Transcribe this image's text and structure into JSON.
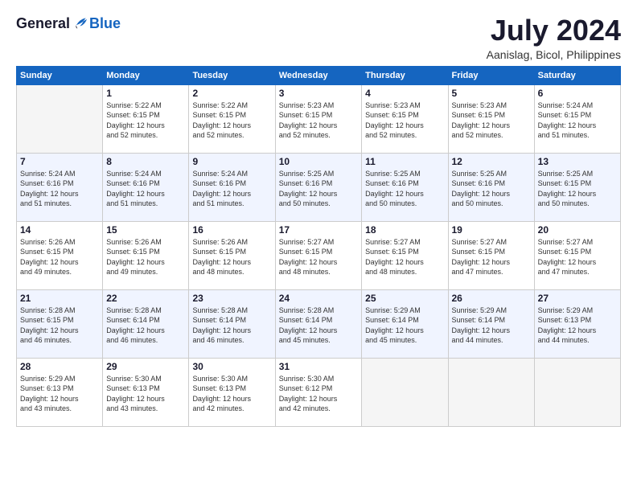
{
  "logo": {
    "general": "General",
    "blue": "Blue"
  },
  "title": "July 2024",
  "location": "Aanislag, Bicol, Philippines",
  "days_of_week": [
    "Sunday",
    "Monday",
    "Tuesday",
    "Wednesday",
    "Thursday",
    "Friday",
    "Saturday"
  ],
  "weeks": [
    [
      {
        "num": "",
        "sunrise": "",
        "sunset": "",
        "daylight": "",
        "empty": true
      },
      {
        "num": "1",
        "sunrise": "Sunrise: 5:22 AM",
        "sunset": "Sunset: 6:15 PM",
        "daylight": "Daylight: 12 hours and 52 minutes."
      },
      {
        "num": "2",
        "sunrise": "Sunrise: 5:22 AM",
        "sunset": "Sunset: 6:15 PM",
        "daylight": "Daylight: 12 hours and 52 minutes."
      },
      {
        "num": "3",
        "sunrise": "Sunrise: 5:23 AM",
        "sunset": "Sunset: 6:15 PM",
        "daylight": "Daylight: 12 hours and 52 minutes."
      },
      {
        "num": "4",
        "sunrise": "Sunrise: 5:23 AM",
        "sunset": "Sunset: 6:15 PM",
        "daylight": "Daylight: 12 hours and 52 minutes."
      },
      {
        "num": "5",
        "sunrise": "Sunrise: 5:23 AM",
        "sunset": "Sunset: 6:15 PM",
        "daylight": "Daylight: 12 hours and 52 minutes."
      },
      {
        "num": "6",
        "sunrise": "Sunrise: 5:24 AM",
        "sunset": "Sunset: 6:15 PM",
        "daylight": "Daylight: 12 hours and 51 minutes."
      }
    ],
    [
      {
        "num": "7",
        "sunrise": "Sunrise: 5:24 AM",
        "sunset": "Sunset: 6:16 PM",
        "daylight": "Daylight: 12 hours and 51 minutes."
      },
      {
        "num": "8",
        "sunrise": "Sunrise: 5:24 AM",
        "sunset": "Sunset: 6:16 PM",
        "daylight": "Daylight: 12 hours and 51 minutes."
      },
      {
        "num": "9",
        "sunrise": "Sunrise: 5:24 AM",
        "sunset": "Sunset: 6:16 PM",
        "daylight": "Daylight: 12 hours and 51 minutes."
      },
      {
        "num": "10",
        "sunrise": "Sunrise: 5:25 AM",
        "sunset": "Sunset: 6:16 PM",
        "daylight": "Daylight: 12 hours and 50 minutes."
      },
      {
        "num": "11",
        "sunrise": "Sunrise: 5:25 AM",
        "sunset": "Sunset: 6:16 PM",
        "daylight": "Daylight: 12 hours and 50 minutes."
      },
      {
        "num": "12",
        "sunrise": "Sunrise: 5:25 AM",
        "sunset": "Sunset: 6:16 PM",
        "daylight": "Daylight: 12 hours and 50 minutes."
      },
      {
        "num": "13",
        "sunrise": "Sunrise: 5:25 AM",
        "sunset": "Sunset: 6:15 PM",
        "daylight": "Daylight: 12 hours and 50 minutes."
      }
    ],
    [
      {
        "num": "14",
        "sunrise": "Sunrise: 5:26 AM",
        "sunset": "Sunset: 6:15 PM",
        "daylight": "Daylight: 12 hours and 49 minutes."
      },
      {
        "num": "15",
        "sunrise": "Sunrise: 5:26 AM",
        "sunset": "Sunset: 6:15 PM",
        "daylight": "Daylight: 12 hours and 49 minutes."
      },
      {
        "num": "16",
        "sunrise": "Sunrise: 5:26 AM",
        "sunset": "Sunset: 6:15 PM",
        "daylight": "Daylight: 12 hours and 48 minutes."
      },
      {
        "num": "17",
        "sunrise": "Sunrise: 5:27 AM",
        "sunset": "Sunset: 6:15 PM",
        "daylight": "Daylight: 12 hours and 48 minutes."
      },
      {
        "num": "18",
        "sunrise": "Sunrise: 5:27 AM",
        "sunset": "Sunset: 6:15 PM",
        "daylight": "Daylight: 12 hours and 48 minutes."
      },
      {
        "num": "19",
        "sunrise": "Sunrise: 5:27 AM",
        "sunset": "Sunset: 6:15 PM",
        "daylight": "Daylight: 12 hours and 47 minutes."
      },
      {
        "num": "20",
        "sunrise": "Sunrise: 5:27 AM",
        "sunset": "Sunset: 6:15 PM",
        "daylight": "Daylight: 12 hours and 47 minutes."
      }
    ],
    [
      {
        "num": "21",
        "sunrise": "Sunrise: 5:28 AM",
        "sunset": "Sunset: 6:15 PM",
        "daylight": "Daylight: 12 hours and 46 minutes."
      },
      {
        "num": "22",
        "sunrise": "Sunrise: 5:28 AM",
        "sunset": "Sunset: 6:14 PM",
        "daylight": "Daylight: 12 hours and 46 minutes."
      },
      {
        "num": "23",
        "sunrise": "Sunrise: 5:28 AM",
        "sunset": "Sunset: 6:14 PM",
        "daylight": "Daylight: 12 hours and 46 minutes."
      },
      {
        "num": "24",
        "sunrise": "Sunrise: 5:28 AM",
        "sunset": "Sunset: 6:14 PM",
        "daylight": "Daylight: 12 hours and 45 minutes."
      },
      {
        "num": "25",
        "sunrise": "Sunrise: 5:29 AM",
        "sunset": "Sunset: 6:14 PM",
        "daylight": "Daylight: 12 hours and 45 minutes."
      },
      {
        "num": "26",
        "sunrise": "Sunrise: 5:29 AM",
        "sunset": "Sunset: 6:14 PM",
        "daylight": "Daylight: 12 hours and 44 minutes."
      },
      {
        "num": "27",
        "sunrise": "Sunrise: 5:29 AM",
        "sunset": "Sunset: 6:13 PM",
        "daylight": "Daylight: 12 hours and 44 minutes."
      }
    ],
    [
      {
        "num": "28",
        "sunrise": "Sunrise: 5:29 AM",
        "sunset": "Sunset: 6:13 PM",
        "daylight": "Daylight: 12 hours and 43 minutes."
      },
      {
        "num": "29",
        "sunrise": "Sunrise: 5:30 AM",
        "sunset": "Sunset: 6:13 PM",
        "daylight": "Daylight: 12 hours and 43 minutes."
      },
      {
        "num": "30",
        "sunrise": "Sunrise: 5:30 AM",
        "sunset": "Sunset: 6:13 PM",
        "daylight": "Daylight: 12 hours and 42 minutes."
      },
      {
        "num": "31",
        "sunrise": "Sunrise: 5:30 AM",
        "sunset": "Sunset: 6:12 PM",
        "daylight": "Daylight: 12 hours and 42 minutes."
      },
      {
        "num": "",
        "sunrise": "",
        "sunset": "",
        "daylight": "",
        "empty": true
      },
      {
        "num": "",
        "sunrise": "",
        "sunset": "",
        "daylight": "",
        "empty": true
      },
      {
        "num": "",
        "sunrise": "",
        "sunset": "",
        "daylight": "",
        "empty": true
      }
    ]
  ]
}
